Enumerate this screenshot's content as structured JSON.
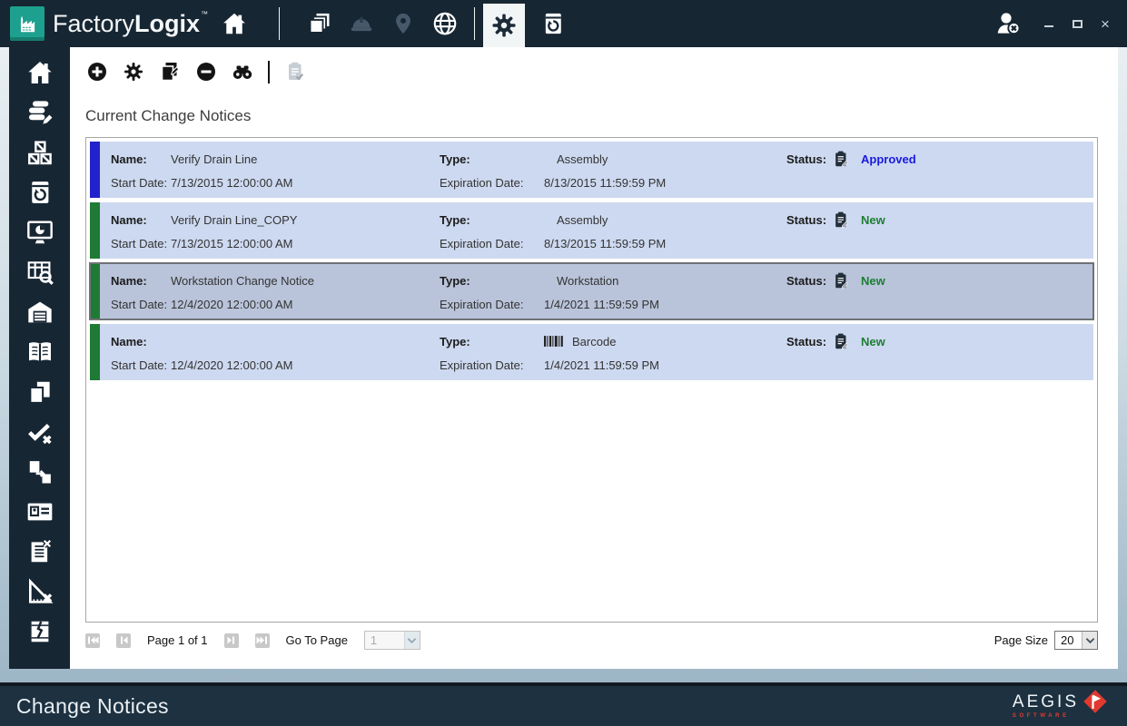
{
  "colors": {
    "titlebar_bg": "#172633",
    "brand_teal": "#1da18e",
    "row_bg": "#cdd9f0",
    "row_selected_bg": "#b9c4da",
    "status_approved": "#1a1ae0",
    "status_new": "#1d7d33",
    "bar_blue": "#2222cc",
    "bar_green": "#1e7a34",
    "aegis_red": "#e23b33"
  },
  "title_bar": {
    "brand": {
      "factory": "Factory",
      "logix": "Logix",
      "tm": "™"
    },
    "nav_icons": [
      "home",
      "layers",
      "hard-hat",
      "map-pin",
      "globe",
      "settings-gear",
      "revision-device"
    ],
    "selected_nav": "settings-gear",
    "user_icon": "user-logout",
    "window_controls": [
      "minimize",
      "maximize",
      "close"
    ]
  },
  "sidebar": {
    "items": [
      "home",
      "data-edit",
      "materials-boxes",
      "revision-device",
      "dashboard-monitor",
      "table-search",
      "warehouse",
      "documentation-book",
      "documents",
      "verify-check",
      "transfer",
      "id-card",
      "defect-list",
      "measure-remove",
      "damaged-package"
    ]
  },
  "toolbar": {
    "buttons": [
      {
        "name": "add",
        "disabled": false
      },
      {
        "name": "settings",
        "disabled": false
      },
      {
        "name": "paste-copy",
        "disabled": false
      },
      {
        "name": "remove",
        "disabled": false
      },
      {
        "name": "find-binoculars",
        "disabled": false
      },
      {
        "name": "approve-document",
        "disabled": true
      }
    ]
  },
  "main": {
    "heading": "Current Change Notices",
    "rows": [
      {
        "name_label": "Name:",
        "name": "Verify Drain Line",
        "start_label": "Start Date:",
        "start_date": "7/13/2015 12:00:00 AM",
        "type_label": "Type:",
        "type": "Assembly",
        "type_icon": "",
        "expiration_label": "Expiration Date:",
        "expiration_date": "8/13/2015 11:59:59 PM",
        "status_label": "Status:",
        "status": "Approved",
        "bar_color": "#2222cc",
        "status_color": "#1a1ae0",
        "selected": false
      },
      {
        "name_label": "Name:",
        "name": "Verify Drain Line_COPY",
        "start_label": "Start Date:",
        "start_date": "7/13/2015 12:00:00 AM",
        "type_label": "Type:",
        "type": "Assembly",
        "type_icon": "",
        "expiration_label": "Expiration Date:",
        "expiration_date": "8/13/2015 11:59:59 PM",
        "status_label": "Status:",
        "status": "New",
        "bar_color": "#1e7a34",
        "status_color": "#1d7d33",
        "selected": false
      },
      {
        "name_label": "Name:",
        "name": "Workstation Change Notice",
        "start_label": "Start Date:",
        "start_date": "12/4/2020 12:00:00 AM",
        "type_label": "Type:",
        "type": "Workstation",
        "type_icon": "",
        "expiration_label": "Expiration Date:",
        "expiration_date": "1/4/2021 11:59:59 PM",
        "status_label": "Status:",
        "status": "New",
        "bar_color": "#1e7a34",
        "status_color": "#1d7d33",
        "selected": true
      },
      {
        "name_label": "Name:",
        "name": "",
        "start_label": "Start Date:",
        "start_date": "12/4/2020 12:00:00 AM",
        "type_label": "Type:",
        "type": "Barcode",
        "type_icon": "barcode",
        "expiration_label": "Expiration Date:",
        "expiration_date": "1/4/2021 11:59:59 PM",
        "status_label": "Status:",
        "status": "New",
        "bar_color": "#1e7a34",
        "status_color": "#1d7d33",
        "selected": false
      }
    ],
    "pagination": {
      "page_text": "Page 1 of 1",
      "goto_label": "Go To Page",
      "goto_value": "1",
      "page_size_label": "Page Size",
      "page_size_value": "20",
      "buttons": [
        "first-page",
        "previous-page",
        "next-page",
        "last-page"
      ]
    }
  },
  "status_bar": {
    "title": "Change Notices",
    "logo_text": "AEGIS",
    "logo_subtext": "SOFTWARE"
  }
}
